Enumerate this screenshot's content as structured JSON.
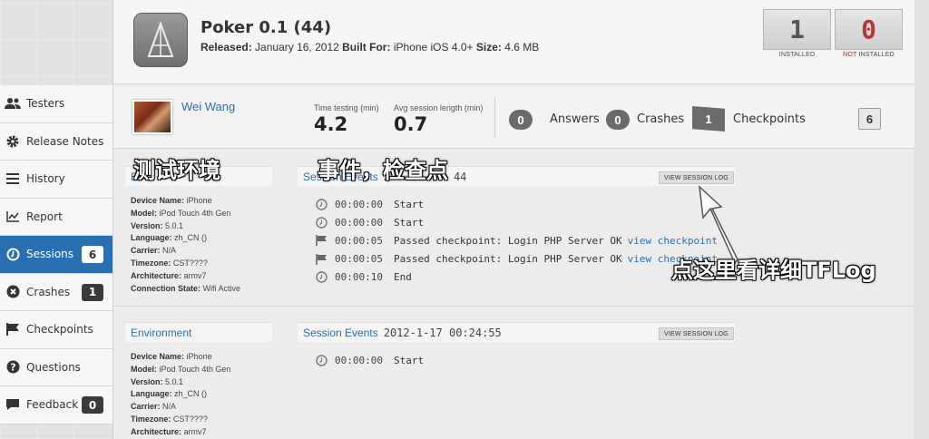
{
  "app": {
    "title": "Poker 0.1 (44)",
    "released_label": "Released:",
    "released_value": "January 16, 2012",
    "built_label": "Built For:",
    "built_value": "iPhone iOS 4.0+",
    "size_label": "Size:",
    "size_value": "4.6 MB"
  },
  "counts": {
    "installed": "1",
    "installed_label": "INSTALLED",
    "not_installed": "0",
    "not_label_red": "NOT",
    "not_label_rest": " INSTALLED"
  },
  "sidebar": {
    "items": [
      {
        "label": "Testers",
        "icon": "users-icon"
      },
      {
        "label": "Release Notes",
        "icon": "gear-icon"
      },
      {
        "label": "History",
        "icon": "list-icon"
      },
      {
        "label": "Report",
        "icon": "chart-icon"
      },
      {
        "label": "Sessions",
        "icon": "clock-icon",
        "badge": "6",
        "active": true
      },
      {
        "label": "Crashes",
        "icon": "x-circle-icon",
        "badge": "1"
      },
      {
        "label": "Checkpoints",
        "icon": "flag-icon"
      },
      {
        "label": "Questions",
        "icon": "question-icon"
      },
      {
        "label": "Feedback",
        "icon": "comment-icon",
        "badge": "0"
      }
    ]
  },
  "session": {
    "tester": "Wei Wang",
    "time_label": "Time testing (min)",
    "time_value": "4.2",
    "avg_label": "Avg session length (min)",
    "avg_value": "0.7",
    "answers_count": "0",
    "answers_label": "Answers",
    "crashes_count": "0",
    "crashes_label": "Crashes",
    "checkpoints_count": "1",
    "checkpoints_label": "Checkpoints",
    "sessions_total": "6"
  },
  "block1": {
    "env_head": "E",
    "events_head": "Session Events",
    "events_ts": "2",
    "events_ts_tail": "44",
    "log_btn": "VIEW SESSION LOG",
    "env": [
      {
        "k": "Device Name:",
        "v": "iPhone"
      },
      {
        "k": "Model:",
        "v": "iPod Touch 4th Gen"
      },
      {
        "k": "Version:",
        "v": "5.0.1"
      },
      {
        "k": "Language:",
        "v": "zh_CN ()"
      },
      {
        "k": "Carrier:",
        "v": "N/A"
      },
      {
        "k": "Timezone:",
        "v": "CST????"
      },
      {
        "k": "Architecture:",
        "v": "armv7"
      },
      {
        "k": "Connection State:",
        "v": "Wifi Active"
      }
    ],
    "events": [
      {
        "icon": "clock",
        "time": "00:00:00",
        "text": "Start",
        "link": ""
      },
      {
        "icon": "clock",
        "time": "00:00:00",
        "text": "Start",
        "link": ""
      },
      {
        "icon": "flag",
        "time": "00:00:05",
        "text": "Passed checkpoint: Login PHP Server OK",
        "link": "view checkpoint"
      },
      {
        "icon": "flag",
        "time": "00:00:05",
        "text": "Passed checkpoint: Login PHP Server OK",
        "link": "view checkpoint"
      },
      {
        "icon": "clock",
        "time": "00:00:10",
        "text": "End",
        "link": ""
      }
    ]
  },
  "block2": {
    "env_head": "Environment",
    "events_head": "Session Events",
    "events_ts": "2012-1-17 00:24:55",
    "log_btn": "VIEW SESSION LOG",
    "env": [
      {
        "k": "Device Name:",
        "v": "iPhone"
      },
      {
        "k": "Model:",
        "v": "iPod Touch 4th Gen"
      },
      {
        "k": "Version:",
        "v": "5.0.1"
      },
      {
        "k": "Language:",
        "v": "zh_CN ()"
      },
      {
        "k": "Carrier:",
        "v": "N/A"
      },
      {
        "k": "Timezone:",
        "v": "CST????"
      },
      {
        "k": "Architecture:",
        "v": "armv7"
      }
    ],
    "events": [
      {
        "icon": "clock",
        "time": "00:00:00",
        "text": "Start",
        "link": ""
      }
    ]
  },
  "annotations": {
    "env_note": "测试环境",
    "events_note": "事件，检查点",
    "log_note": "点这里看详细TFLog"
  }
}
